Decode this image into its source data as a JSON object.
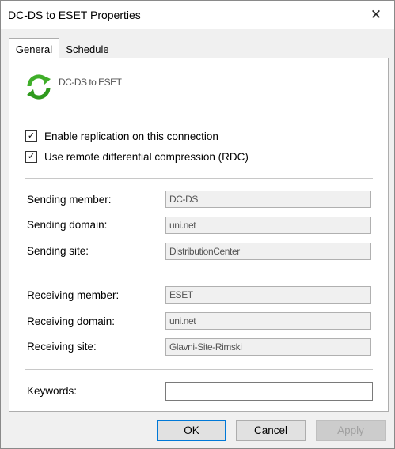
{
  "window": {
    "title": "DC-DS to ESET Properties",
    "close_glyph": "✕"
  },
  "tabs": [
    {
      "label": "General"
    },
    {
      "label": "Schedule"
    }
  ],
  "connection": {
    "name": "DC-DS to ESET",
    "icon": "replication-arrows-icon"
  },
  "options": {
    "enable_replication": {
      "label": "Enable replication on this connection",
      "checked": true
    },
    "use_rdc": {
      "label": "Use remote differential compression (RDC)",
      "checked": true
    }
  },
  "sending": {
    "member": {
      "label": "Sending member:",
      "value": "DC-DS"
    },
    "domain": {
      "label": "Sending domain:",
      "value": "uni.net"
    },
    "site": {
      "label": "Sending site:",
      "value": "DistributionCenter"
    }
  },
  "receiving": {
    "member": {
      "label": "Receiving member:",
      "value": "ESET"
    },
    "domain": {
      "label": "Receiving domain:",
      "value": "uni.net"
    },
    "site": {
      "label": "Receiving site:",
      "value": "Glavni-Site-Rimski"
    }
  },
  "keywords": {
    "label": "Keywords:",
    "value": ""
  },
  "buttons": {
    "ok": "OK",
    "cancel": "Cancel",
    "apply": "Apply"
  },
  "colors": {
    "accent": "#0078d7",
    "icon_green": "#3fae29"
  }
}
